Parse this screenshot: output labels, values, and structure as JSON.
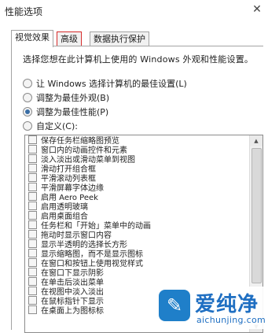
{
  "window": {
    "title": "性能选项",
    "close_glyph": "✕"
  },
  "tabs": [
    {
      "label": "视觉效果"
    },
    {
      "label": "高级"
    },
    {
      "label": "数据执行保护"
    }
  ],
  "panel": {
    "description": "选择您想在此计算机上使用的 Windows 外观和性能设置。",
    "options": [
      {
        "label": "让 Windows 选择计算机的最佳设置(L)",
        "checked": false
      },
      {
        "label": "调整为最佳外观(B)",
        "checked": false
      },
      {
        "label": "调整为最佳性能(P)",
        "checked": true
      },
      {
        "label": "自定义(C):",
        "checked": false
      }
    ]
  },
  "effects": [
    "保存任务栏缩略图预览",
    "窗口内的动画控件和元素",
    "淡入淡出或滑动菜单到视图",
    "滑动打开组合框",
    "平滑滚动列表框",
    "平滑屏幕字体边缘",
    "启用 Aero Peek",
    "启用透明玻璃",
    "启用桌面组合",
    "任务栏和「开始」菜单中的动画",
    "拖动时显示窗口内容",
    "显示半透明的选择长方形",
    "显示缩略图，而不是显示图标",
    "在窗口和按钮上使用视觉样式",
    "在窗口下显示阴影",
    "在单击后淡出菜单",
    "在视图中淡入淡出",
    "在鼠标指针下显示",
    "在桌面上为图标标"
  ],
  "scrollbar": {
    "up_glyph": "▲",
    "down_glyph": "▼"
  },
  "watermark": {
    "logo_glyph": "✎",
    "brand": "爱纯净",
    "url": "aichunjing.com"
  }
}
